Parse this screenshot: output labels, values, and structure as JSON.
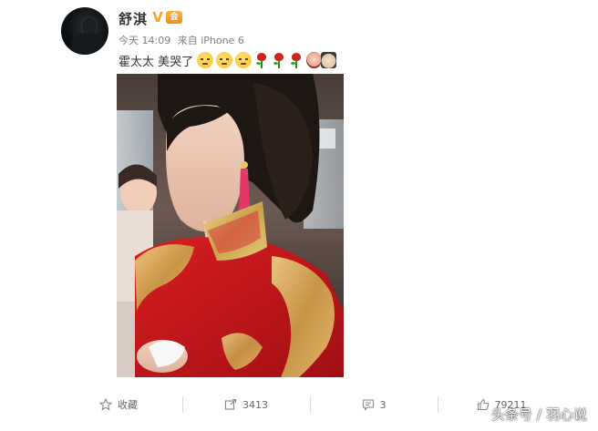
{
  "post": {
    "author": {
      "name": "舒淇",
      "verified_mark": "V",
      "vip_badge_text": "会"
    },
    "meta": {
      "time": "今天 14:09",
      "source": "来自 iPhone 6"
    },
    "text": "霍太太 美哭了",
    "emojis": [
      "sad-face",
      "sad-face",
      "sad-face",
      "rose",
      "rose",
      "rose",
      "couple-sticker"
    ],
    "photo": {
      "description_icon": "bride-photo"
    }
  },
  "actions": {
    "favorite_label": "收藏",
    "repost_count": "3413",
    "comment_count": "3",
    "like_count": "79211"
  },
  "watermark": {
    "platform": "头条号",
    "separator": "/",
    "account": "羽心说"
  },
  "colors": {
    "verified": "#f5a623",
    "vip_badge": "#f08a24",
    "text_primary": "#333333",
    "text_secondary": "#808080"
  }
}
